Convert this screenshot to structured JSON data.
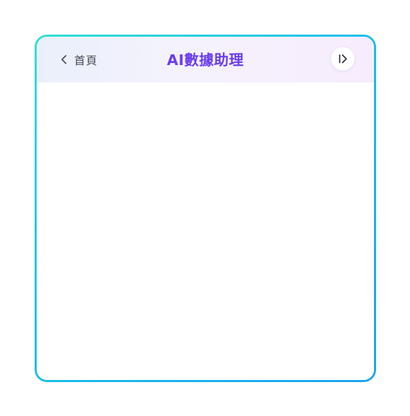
{
  "header": {
    "back_label": "首頁",
    "title": "AI數據助理"
  },
  "icons": {
    "back": "chevron-left-icon",
    "collapse": "collapse-panel-icon"
  },
  "colors": {
    "title": "#6a3cf0",
    "border_start": "#2fe0d0",
    "border_end": "#1aa2f2"
  }
}
